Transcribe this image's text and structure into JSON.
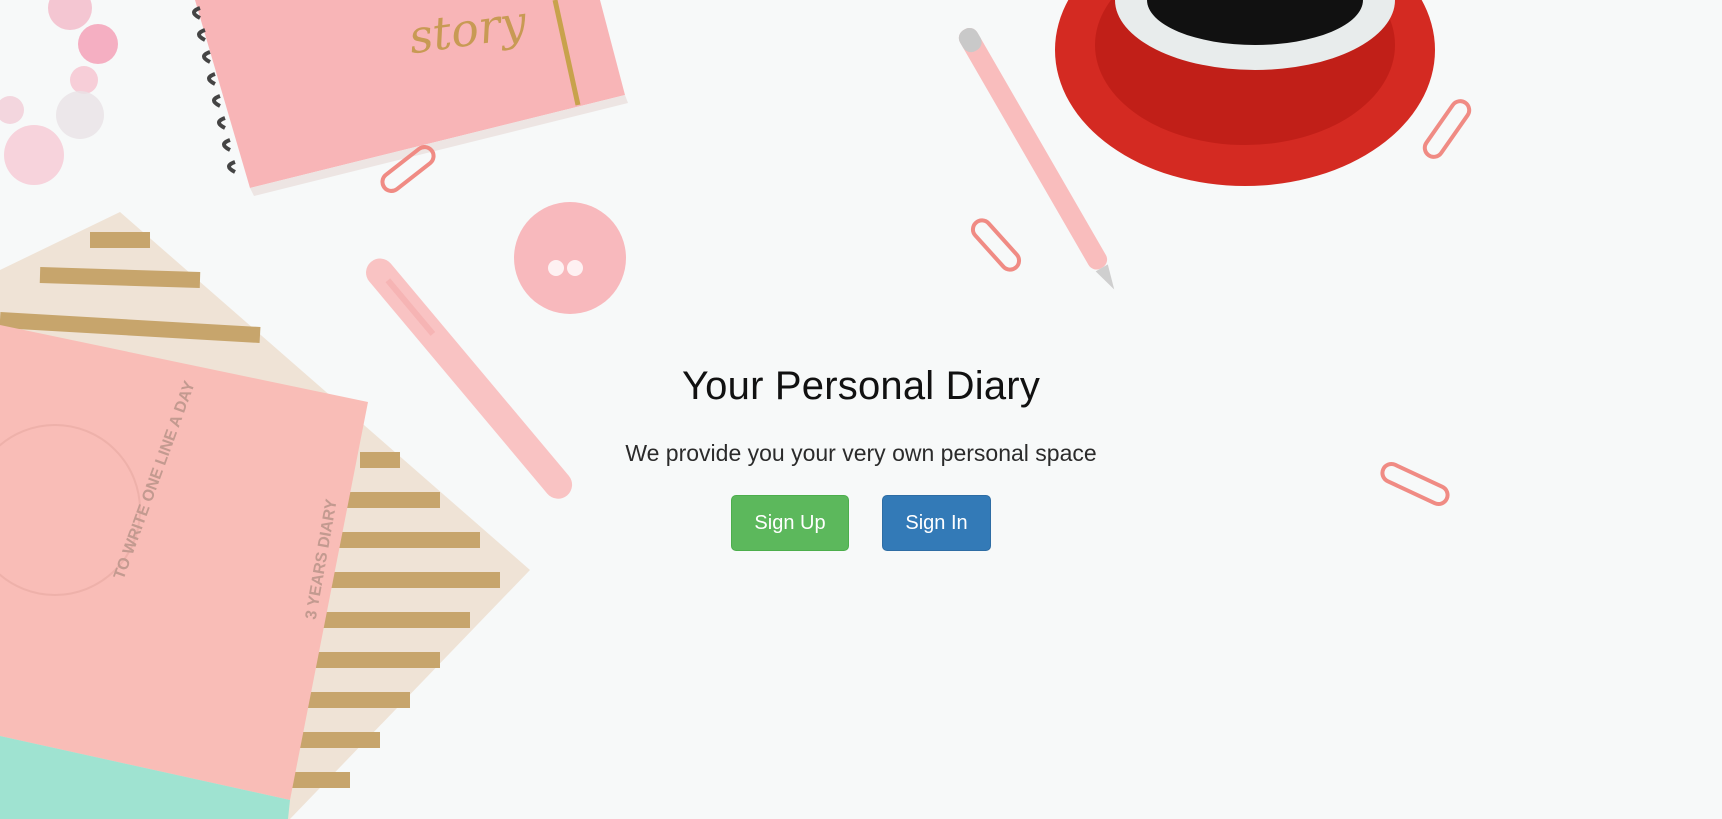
{
  "hero": {
    "title": "Your Personal Diary",
    "subtitle": "We provide you your very own personal space"
  },
  "actions": {
    "signup_label": "Sign Up",
    "signin_label": "Sign In"
  },
  "background": {
    "notebook_script": "story",
    "diary_cover_circle_text": "TO WRITE ONE LINE A DAY",
    "diary_spine_text": "3 YEARS DIARY"
  },
  "colors": {
    "signup": "#5cb85c",
    "signin": "#337ab7",
    "background": "#f7f9f9",
    "pink": "#f9b8b5",
    "cup_red": "#d42a22"
  }
}
